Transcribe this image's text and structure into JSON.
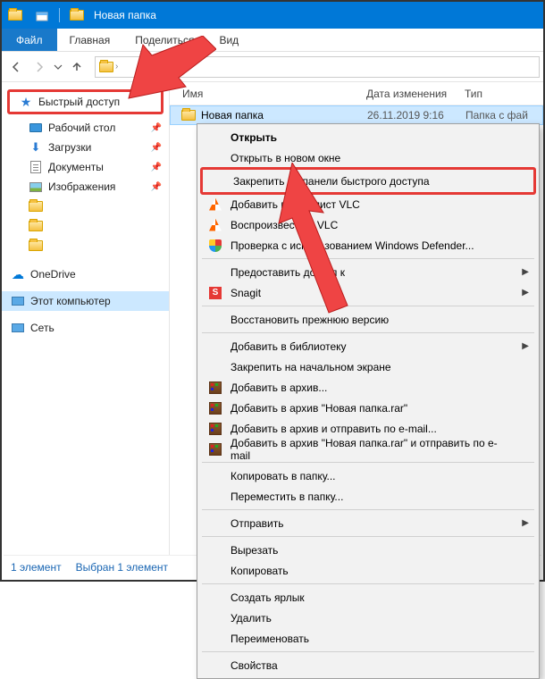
{
  "window": {
    "title": "Новая папка"
  },
  "menubar": {
    "file": "Файл",
    "home": "Главная",
    "share": "Поделиться",
    "view": "Вид"
  },
  "sidebar": {
    "quick_access": "Быстрый доступ",
    "desktop": "Рабочий стол",
    "downloads": "Загрузки",
    "documents": "Документы",
    "pictures": "Изображения",
    "onedrive": "OneDrive",
    "this_pc": "Этот компьютер",
    "network": "Сеть"
  },
  "columns": {
    "name": "Имя",
    "date": "Дата изменения",
    "type": "Тип"
  },
  "listing": {
    "row0": {
      "name": "Новая папка",
      "date": "26.11.2019 9:16",
      "type": "Папка с фай"
    }
  },
  "statusbar": {
    "count": "1 элемент",
    "selection": "Выбран 1 элемент"
  },
  "context_menu": {
    "open": "Открыть",
    "open_new_window": "Открыть в новом окне",
    "pin_quick_access": "Закрепить на панели быстрого доступа",
    "vlc_playlist": "Добавить в плейлист VLC",
    "vlc_play": "Воспроизвести в VLC",
    "defender": "Проверка с использованием Windows Defender...",
    "grant_access": "Предоставить доступ к",
    "snagit": "Snagit",
    "restore_prev": "Восстановить прежнюю версию",
    "add_library": "Добавить в библиотеку",
    "pin_start": "Закрепить на начальном экране",
    "rar_add": "Добавить в архив...",
    "rar_add_named": "Добавить в архив \"Новая папка.rar\"",
    "rar_email": "Добавить в архив и отправить по e-mail...",
    "rar_named_email": "Добавить в архив \"Новая папка.rar\" и отправить по e-mail",
    "copy_folder": "Копировать в папку...",
    "move_folder": "Переместить в папку...",
    "send_to": "Отправить",
    "cut": "Вырезать",
    "copy": "Копировать",
    "shortcut": "Создать ярлык",
    "delete": "Удалить",
    "rename": "Переименовать",
    "properties": "Свойства"
  }
}
